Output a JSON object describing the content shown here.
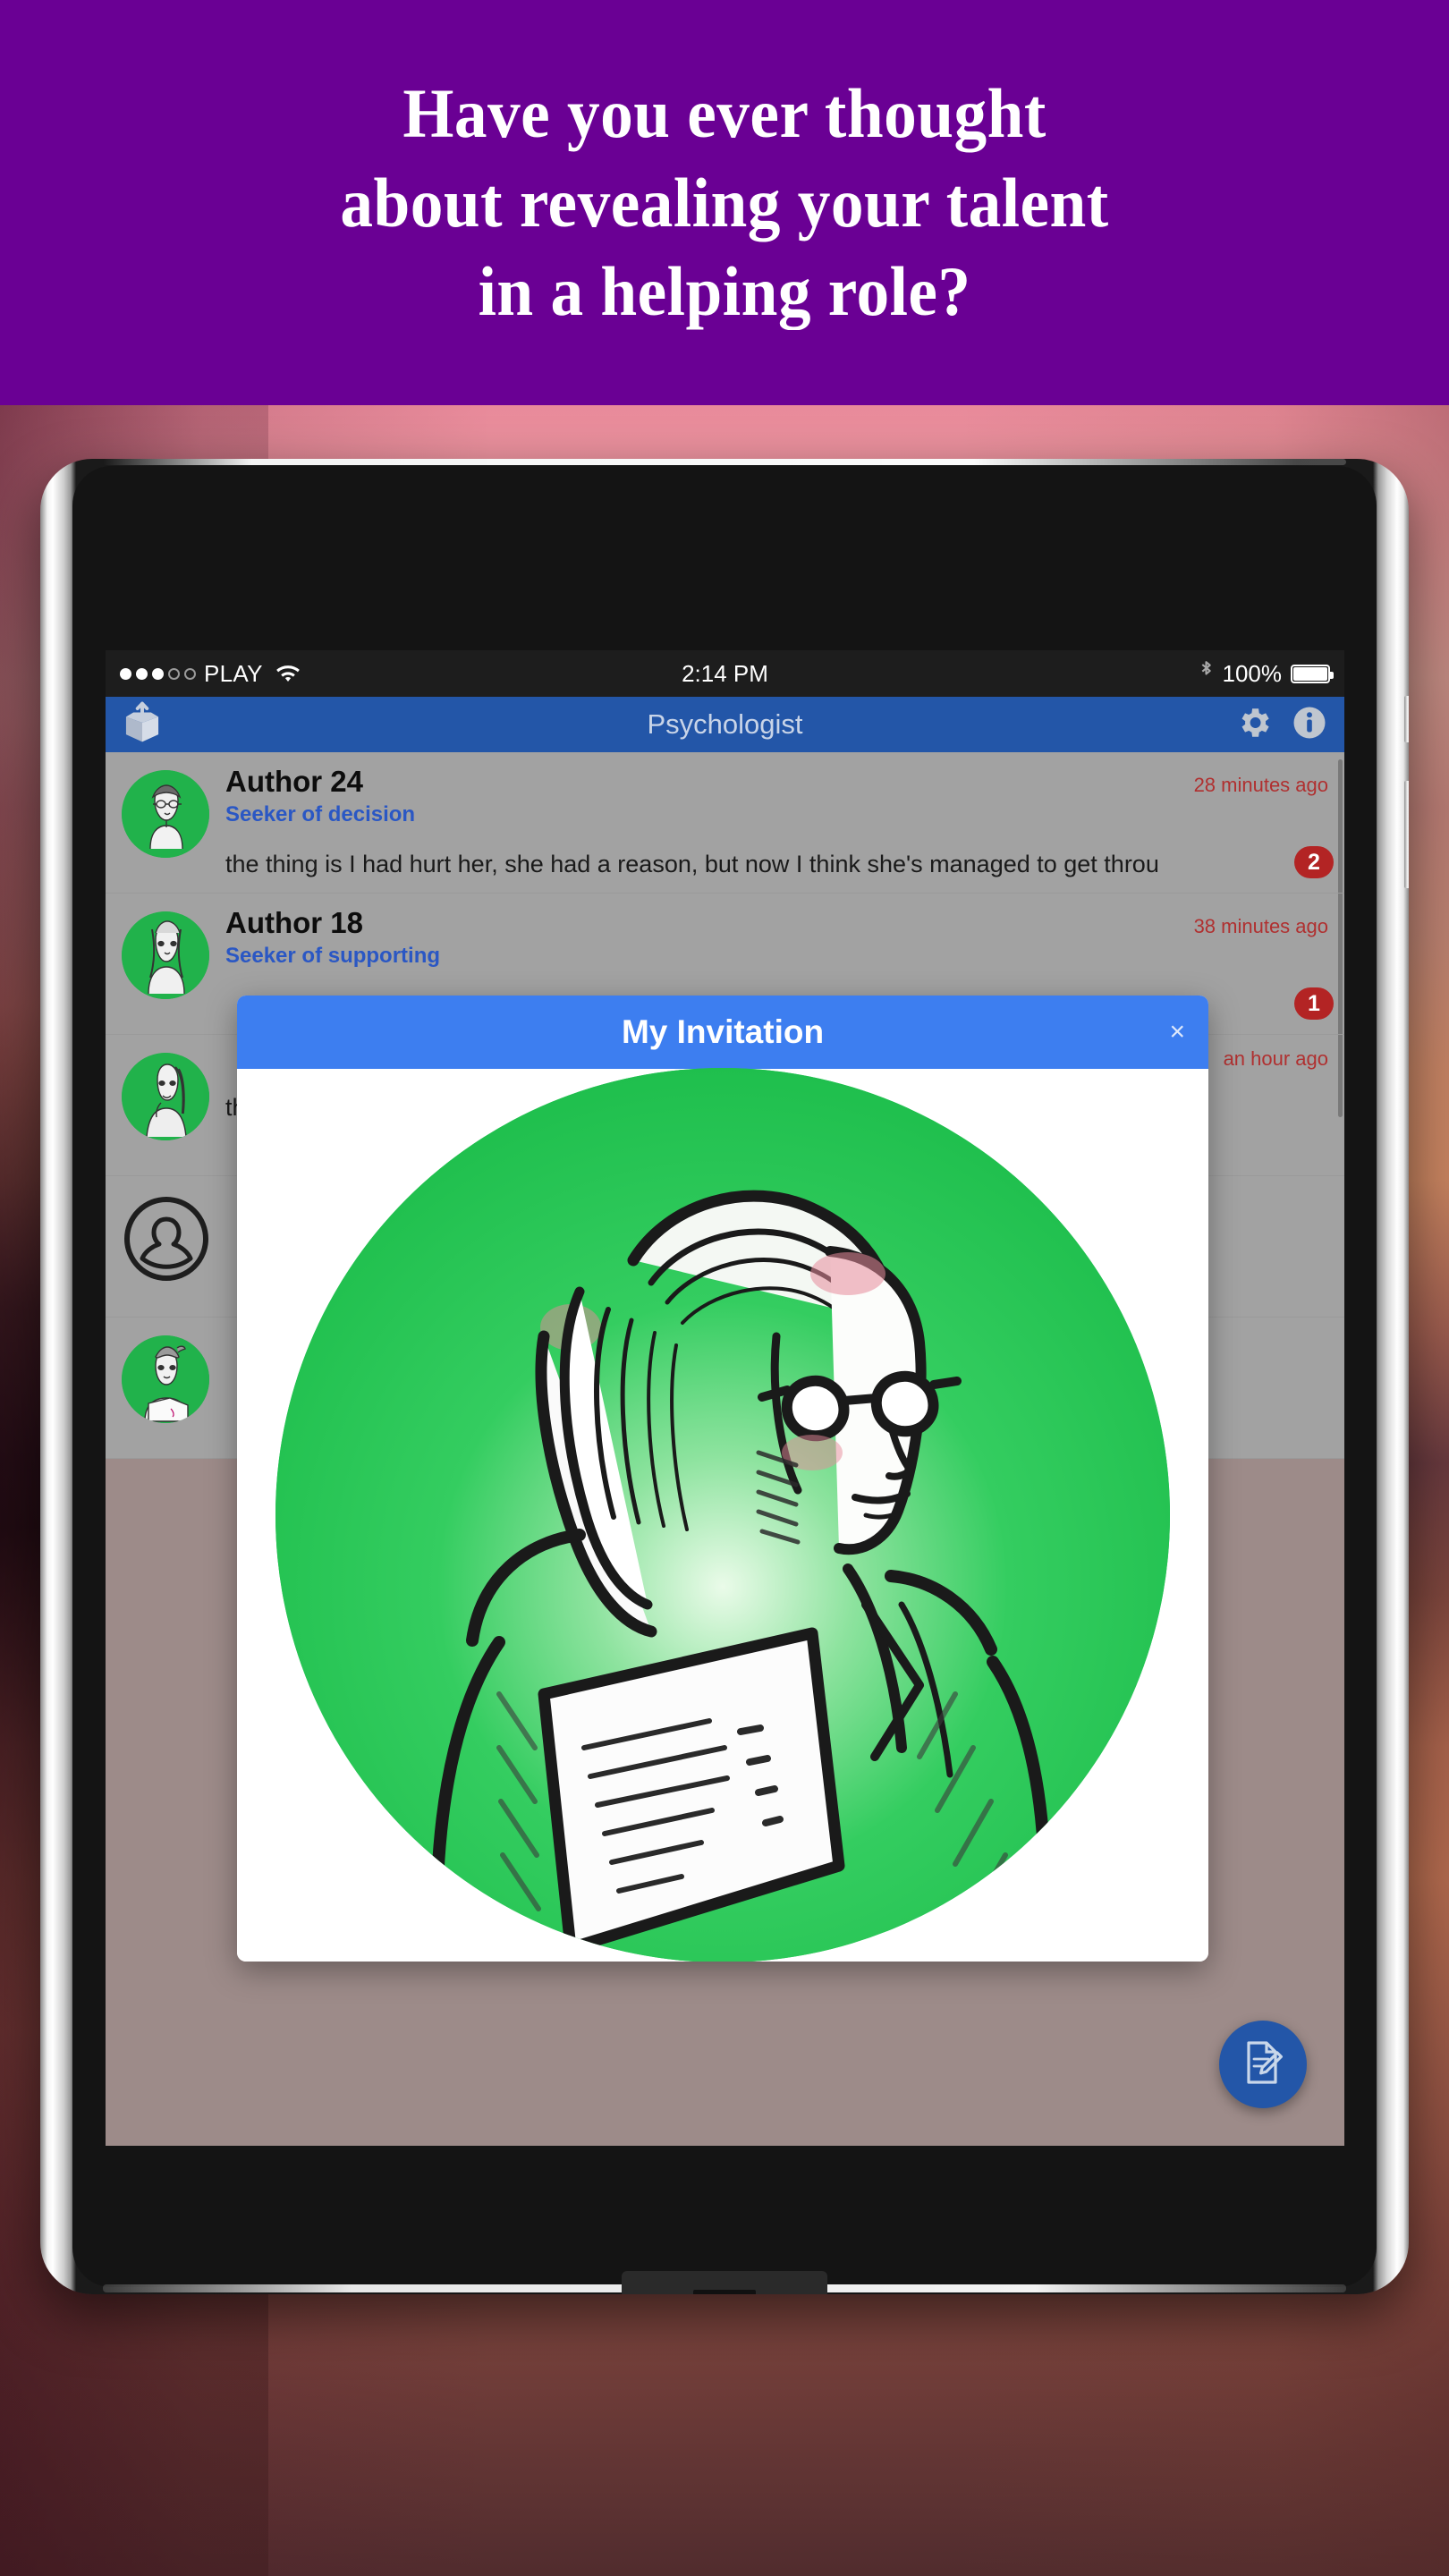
{
  "promo": {
    "headline": "Have you ever thought\nabout revealing your talent\nin a helping role?",
    "background_color": "#6a0094",
    "text_color": "#ffffff"
  },
  "device": {
    "type": "tablet",
    "frame_color": "#c8c8c8",
    "screen_background": "#a2a2a2"
  },
  "status_bar": {
    "carrier": "PLAY",
    "signal_bars_filled": 3,
    "signal_bars_total": 5,
    "wifi_icon": "wifi-icon",
    "time": "2:14 PM",
    "bluetooth_icon": "bluetooth-icon",
    "battery_percent": "100%",
    "background_color": "#1d1d1d"
  },
  "app_bar": {
    "title": "Psychologist",
    "left_icon": "open-box-upload-icon",
    "right_icons": [
      "gear-icon",
      "info-icon"
    ],
    "background_color": "#2356a8",
    "title_color": "#c8d4e8"
  },
  "list": {
    "rows": [
      {
        "author": "Author 24",
        "role": "Seeker of decision",
        "timestamp": "28 minutes ago",
        "message": "the thing is I had hurt her, she had a reason, but now I think she's managed to get throu",
        "badge": "2",
        "avatar": "sketch-portrait-glasses-avatar"
      },
      {
        "author": "Author 18",
        "role": "Seeker of supporting",
        "timestamp": "38 minutes ago",
        "message": "",
        "badge": "1",
        "avatar": "sketch-portrait-long-hair-avatar"
      },
      {
        "author": "",
        "role": "",
        "timestamp": "an hour ago",
        "message": "this? W…",
        "badge": "",
        "avatar": "sketch-portrait-thinking-avatar"
      },
      {
        "author": "",
        "role": "",
        "timestamp": "",
        "message": "",
        "badge": "",
        "avatar": "default-person-outline-avatar"
      },
      {
        "author": "",
        "role": "",
        "timestamp": "",
        "message": "",
        "badge": "",
        "avatar": "sketch-portrait-notes-avatar"
      }
    ],
    "timestamp_color": "#b03030",
    "role_color": "#2a57c4",
    "badge_color": "#b32424"
  },
  "modal": {
    "title": "My Invitation",
    "close_label": "×",
    "header_color": "#3d7ef0",
    "image": "psychologist-sketch-portrait-green-circle",
    "image_background_color": "#22c552"
  },
  "fab": {
    "icon": "compose-document-pencil-icon",
    "color": "#2356a8"
  }
}
